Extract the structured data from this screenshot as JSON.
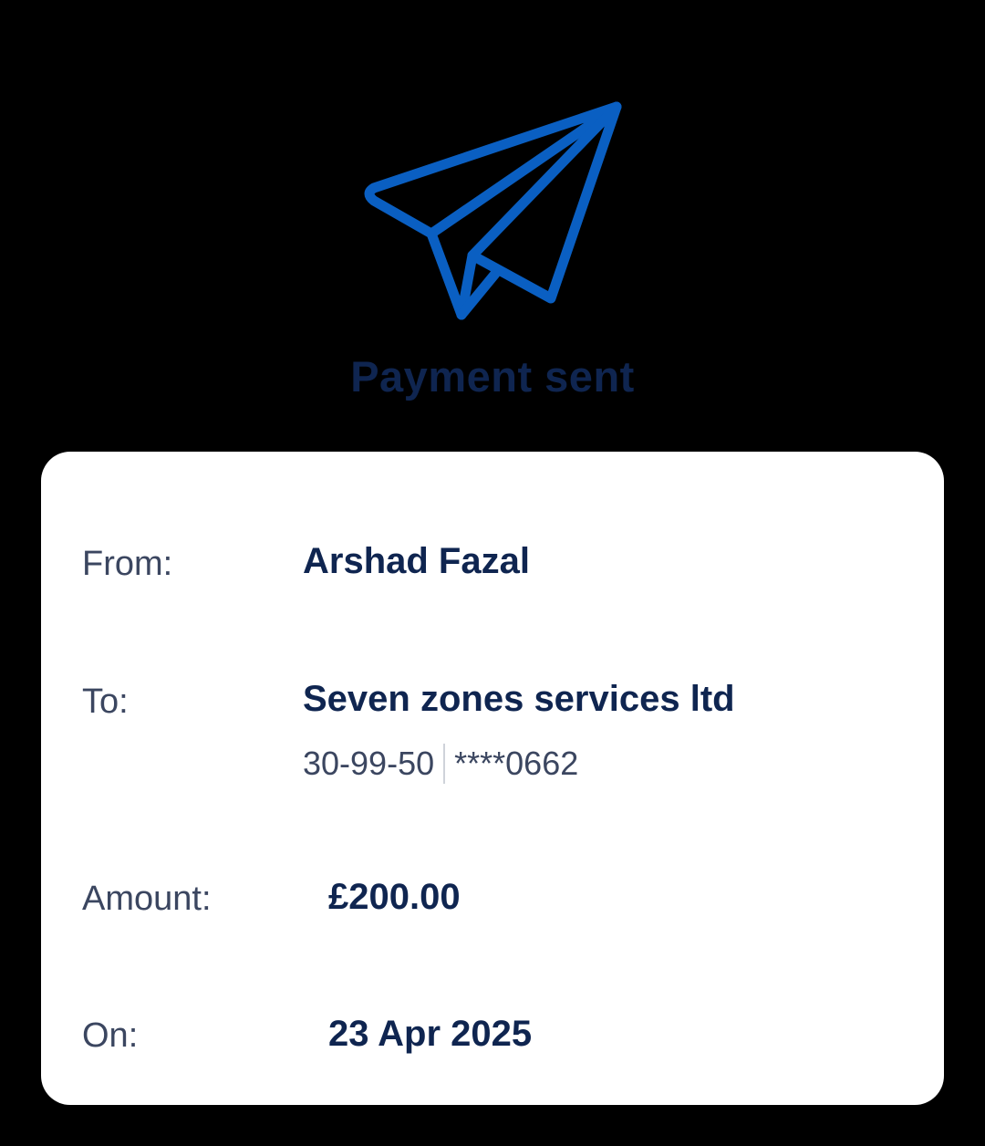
{
  "header": {
    "icon": "paper-plane-icon",
    "title": "Payment sent",
    "icon_color": "#0a5fc2",
    "title_color": "#0f2550"
  },
  "details": {
    "from_label": "From:",
    "from_value": "Arshad Fazal",
    "to_label": "To:",
    "to_value": "Seven zones services ltd",
    "sort_code": "30-99-50",
    "account_number": "****0662",
    "amount_label": "Amount:",
    "amount_value": "£200.00",
    "on_label": "On:",
    "on_value": "23 Apr 2025"
  }
}
